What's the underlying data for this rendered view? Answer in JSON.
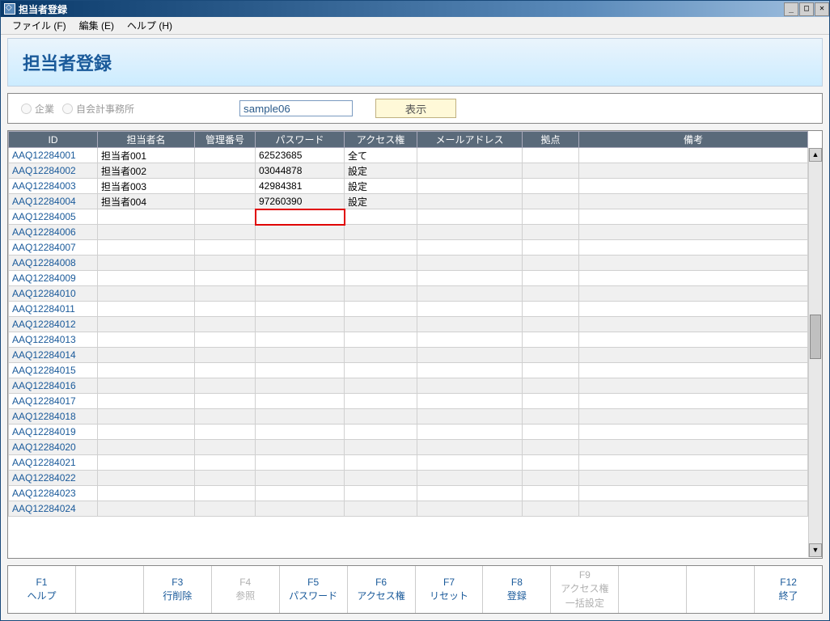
{
  "window": {
    "title": "担当者登録"
  },
  "menu": {
    "file": "ファイル (F)",
    "edit": "編集 (E)",
    "help": "ヘルプ (H)"
  },
  "pageTitle": "担当者登録",
  "filter": {
    "radio1": "企業",
    "radio2": "自会計事務所",
    "sampleValue": "sample06",
    "showBtn": "表示"
  },
  "columns": [
    "ID",
    "担当者名",
    "管理番号",
    "パスワード",
    "アクセス権",
    "メールアドレス",
    "拠点",
    "備考"
  ],
  "rows": [
    {
      "id": "AAQ12284001",
      "name": "担当者001",
      "mgmt": "",
      "pwd": "62523685",
      "access": "全て",
      "mail": "",
      "base": "",
      "note": ""
    },
    {
      "id": "AAQ12284002",
      "name": "担当者002",
      "mgmt": "",
      "pwd": "03044878",
      "access": "設定",
      "mail": "",
      "base": "",
      "note": ""
    },
    {
      "id": "AAQ12284003",
      "name": "担当者003",
      "mgmt": "",
      "pwd": "42984381",
      "access": "設定",
      "mail": "",
      "base": "",
      "note": ""
    },
    {
      "id": "AAQ12284004",
      "name": "担当者004",
      "mgmt": "",
      "pwd": "97260390",
      "access": "設定",
      "mail": "",
      "base": "",
      "note": ""
    },
    {
      "id": "AAQ12284005",
      "name": "",
      "mgmt": "",
      "pwd": "",
      "access": "",
      "mail": "",
      "base": "",
      "note": "",
      "pwdRed": true
    },
    {
      "id": "AAQ12284006",
      "name": "",
      "mgmt": "",
      "pwd": "",
      "access": "",
      "mail": "",
      "base": "",
      "note": ""
    },
    {
      "id": "AAQ12284007",
      "name": "",
      "mgmt": "",
      "pwd": "",
      "access": "",
      "mail": "",
      "base": "",
      "note": ""
    },
    {
      "id": "AAQ12284008",
      "name": "",
      "mgmt": "",
      "pwd": "",
      "access": "",
      "mail": "",
      "base": "",
      "note": ""
    },
    {
      "id": "AAQ12284009",
      "name": "",
      "mgmt": "",
      "pwd": "",
      "access": "",
      "mail": "",
      "base": "",
      "note": ""
    },
    {
      "id": "AAQ12284010",
      "name": "",
      "mgmt": "",
      "pwd": "",
      "access": "",
      "mail": "",
      "base": "",
      "note": ""
    },
    {
      "id": "AAQ12284011",
      "name": "",
      "mgmt": "",
      "pwd": "",
      "access": "",
      "mail": "",
      "base": "",
      "note": ""
    },
    {
      "id": "AAQ12284012",
      "name": "",
      "mgmt": "",
      "pwd": "",
      "access": "",
      "mail": "",
      "base": "",
      "note": ""
    },
    {
      "id": "AAQ12284013",
      "name": "",
      "mgmt": "",
      "pwd": "",
      "access": "",
      "mail": "",
      "base": "",
      "note": ""
    },
    {
      "id": "AAQ12284014",
      "name": "",
      "mgmt": "",
      "pwd": "",
      "access": "",
      "mail": "",
      "base": "",
      "note": ""
    },
    {
      "id": "AAQ12284015",
      "name": "",
      "mgmt": "",
      "pwd": "",
      "access": "",
      "mail": "",
      "base": "",
      "note": ""
    },
    {
      "id": "AAQ12284016",
      "name": "",
      "mgmt": "",
      "pwd": "",
      "access": "",
      "mail": "",
      "base": "",
      "note": ""
    },
    {
      "id": "AAQ12284017",
      "name": "",
      "mgmt": "",
      "pwd": "",
      "access": "",
      "mail": "",
      "base": "",
      "note": ""
    },
    {
      "id": "AAQ12284018",
      "name": "",
      "mgmt": "",
      "pwd": "",
      "access": "",
      "mail": "",
      "base": "",
      "note": ""
    },
    {
      "id": "AAQ12284019",
      "name": "",
      "mgmt": "",
      "pwd": "",
      "access": "",
      "mail": "",
      "base": "",
      "note": ""
    },
    {
      "id": "AAQ12284020",
      "name": "",
      "mgmt": "",
      "pwd": "",
      "access": "",
      "mail": "",
      "base": "",
      "note": ""
    },
    {
      "id": "AAQ12284021",
      "name": "",
      "mgmt": "",
      "pwd": "",
      "access": "",
      "mail": "",
      "base": "",
      "note": ""
    },
    {
      "id": "AAQ12284022",
      "name": "",
      "mgmt": "",
      "pwd": "",
      "access": "",
      "mail": "",
      "base": "",
      "note": ""
    },
    {
      "id": "AAQ12284023",
      "name": "",
      "mgmt": "",
      "pwd": "",
      "access": "",
      "mail": "",
      "base": "",
      "note": ""
    },
    {
      "id": "AAQ12284024",
      "name": "",
      "mgmt": "",
      "pwd": "",
      "access": "",
      "mail": "",
      "base": "",
      "note": ""
    }
  ],
  "fbar": [
    {
      "key": "F1",
      "label": "ヘルプ",
      "enabled": true
    },
    {
      "key": "",
      "label": "",
      "enabled": false,
      "blank": true
    },
    {
      "key": "F3",
      "label": "行削除",
      "enabled": true
    },
    {
      "key": "F4",
      "label": "参照",
      "enabled": false
    },
    {
      "key": "F5",
      "label": "パスワード",
      "enabled": true
    },
    {
      "key": "F6",
      "label": "アクセス権",
      "enabled": true
    },
    {
      "key": "F7",
      "label": "リセット",
      "enabled": true
    },
    {
      "key": "F8",
      "label": "登録",
      "enabled": true
    },
    {
      "key": "F9",
      "label": "アクセス権",
      "label2": "一括設定",
      "enabled": false
    },
    {
      "key": "",
      "label": "",
      "enabled": false,
      "blank": true
    },
    {
      "key": "",
      "label": "",
      "enabled": false,
      "blank": true
    },
    {
      "key": "F12",
      "label": "終了",
      "enabled": true
    }
  ],
  "winctrl": {
    "min": "_",
    "max": "□",
    "close": "✕"
  }
}
